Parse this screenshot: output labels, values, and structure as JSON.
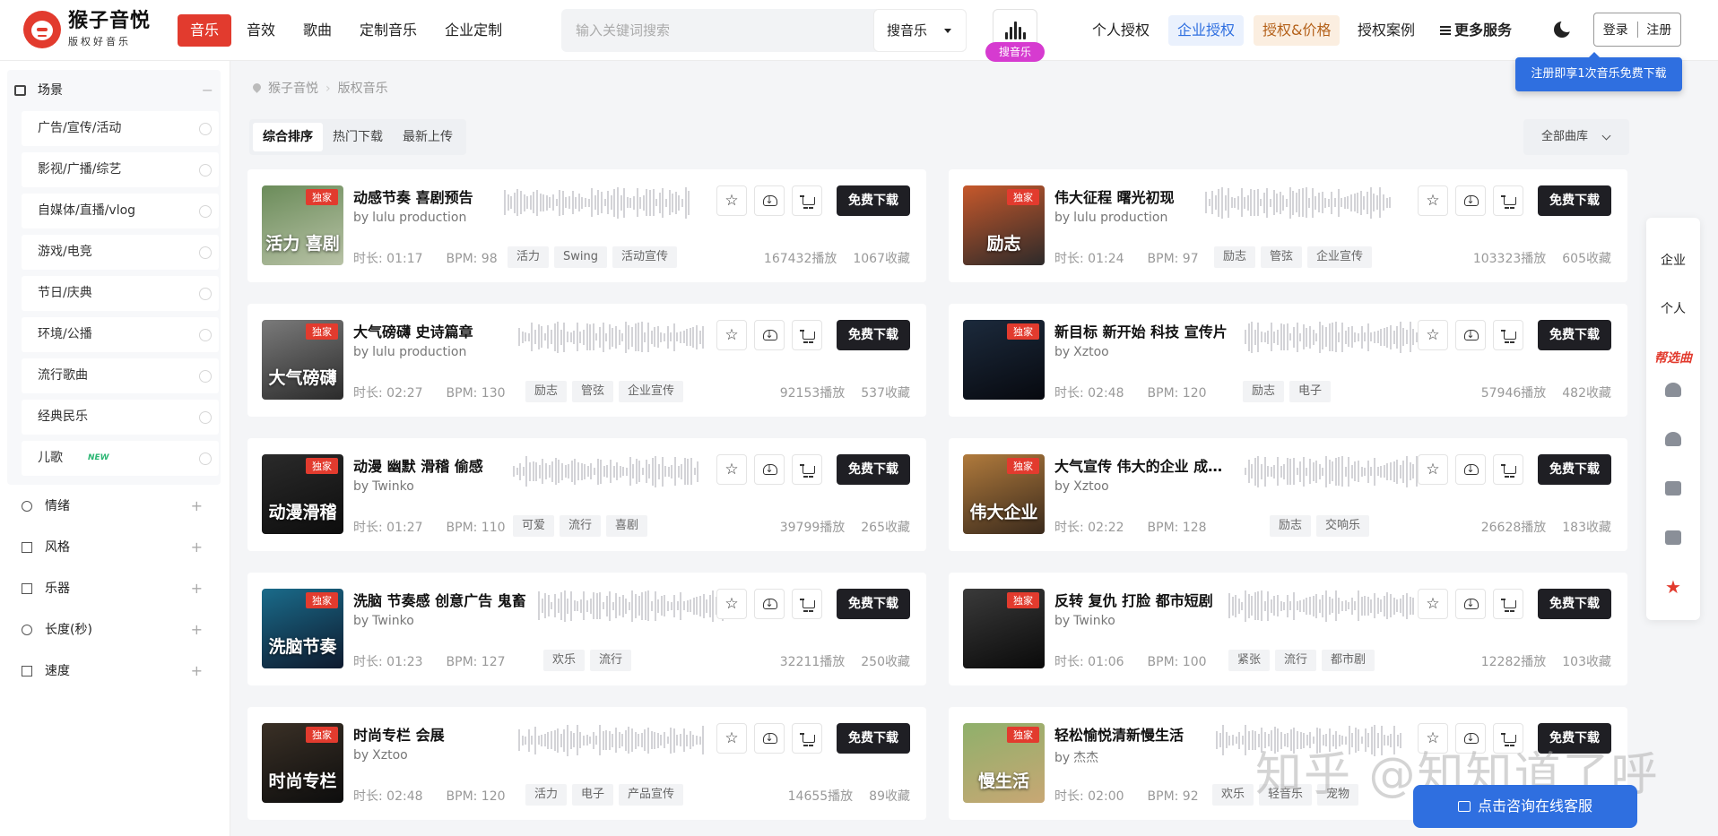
{
  "brand": {
    "name": "猴子音悦",
    "tagline": "版权好音乐"
  },
  "nav": {
    "items": [
      "音乐",
      "音效",
      "歌曲",
      "定制音乐",
      "企业定制"
    ]
  },
  "search": {
    "placeholder": "输入关键词搜索",
    "scope": "搜音乐",
    "voice_badge": "搜音乐"
  },
  "right_nav": {
    "personal": "个人授权",
    "enterprise": "企业授权",
    "pricing": "授权&价格",
    "cases": "授权案例",
    "more": "更多服务"
  },
  "auth": {
    "login": "登录",
    "register": "注册"
  },
  "promo": {
    "text": "注册即享1次音乐免费下载"
  },
  "sidebar": {
    "scene_title": "场景",
    "scenes": [
      {
        "label": "广告/宣传/活动"
      },
      {
        "label": "影视/广播/综艺"
      },
      {
        "label": "自媒体/直播/vlog"
      },
      {
        "label": "游戏/电竞"
      },
      {
        "label": "节日/庆典"
      },
      {
        "label": "环境/公播"
      },
      {
        "label": "流行歌曲"
      },
      {
        "label": "经典民乐"
      },
      {
        "label": "儿歌",
        "badge": "NEW"
      }
    ],
    "categories": [
      "情绪",
      "风格",
      "乐器",
      "长度(秒)",
      "速度"
    ]
  },
  "breadcrumb": {
    "home": "猴子音悦",
    "current": "版权音乐"
  },
  "sort_tabs": [
    "综合排序",
    "热门下载",
    "最新上传"
  ],
  "library": {
    "label": "全部曲库"
  },
  "labels": {
    "exclusive": "独家",
    "free_download": "免费下载",
    "by": "by"
  },
  "tracks": [
    {
      "title": "动感节奏 喜剧预告",
      "author": "lulu production",
      "duration": "时长: 01:17",
      "bpm": "BPM: 98",
      "tags": [
        "活力",
        "Swing",
        "活动宣传"
      ],
      "plays": "167432播放",
      "favs": "1067收藏",
      "cover_text": "活力 喜剧",
      "cover_colors": [
        "#6b8c5a",
        "#b8c2a6"
      ]
    },
    {
      "title": "伟大征程 曙光初现",
      "author": "lulu production",
      "duration": "时长: 01:24",
      "bpm": "BPM: 97",
      "tags": [
        "励志",
        "管弦",
        "企业宣传"
      ],
      "plays": "103323播放",
      "favs": "605收藏",
      "cover_text": "励志",
      "cover_colors": [
        "#c6582b",
        "#2d2a2a"
      ]
    },
    {
      "title": "大气磅礴 史诗篇章",
      "author": "lulu production",
      "duration": "时长: 02:27",
      "bpm": "BPM: 130",
      "tags": [
        "励志",
        "管弦",
        "企业宣传"
      ],
      "plays": "92153播放",
      "favs": "537收藏",
      "cover_text": "大气磅礴",
      "cover_colors": [
        "#7a7a7a",
        "#2b2b2b"
      ]
    },
    {
      "title": "新目标 新开始 科技 宣传片",
      "author": "Xztoo",
      "duration": "时长: 02:48",
      "bpm": "BPM: 120",
      "tags": [
        "励志",
        "电子"
      ],
      "plays": "57946播放",
      "favs": "482收藏",
      "cover_text": "",
      "cover_colors": [
        "#1c2a3c",
        "#07090f"
      ]
    },
    {
      "title": "动漫 幽默 滑稽 偷感",
      "author": "Twinko",
      "duration": "时长: 01:27",
      "bpm": "BPM: 110",
      "tags": [
        "可爱",
        "流行",
        "喜剧"
      ],
      "plays": "39799播放",
      "favs": "265收藏",
      "cover_text": "动漫滑稽",
      "cover_colors": [
        "#2a2a2a",
        "#0d0d0d"
      ]
    },
    {
      "title": "大气宣传 伟大的企业 成…",
      "author": "Xztoo",
      "duration": "时长: 02:22",
      "bpm": "BPM: 128",
      "tags": [
        "励志",
        "交响乐"
      ],
      "plays": "26628播放",
      "favs": "183收藏",
      "cover_text": "伟大企业",
      "cover_colors": [
        "#b07a3c",
        "#3a2a1c"
      ]
    },
    {
      "title": "洗脑 节奏感 创意广告 鬼畜",
      "author": "Twinko",
      "duration": "时长: 01:23",
      "bpm": "BPM: 127",
      "tags": [
        "欢乐",
        "流行"
      ],
      "plays": "32211播放",
      "favs": "250收藏",
      "cover_text": "洗脑节奏",
      "cover_colors": [
        "#1a6b8a",
        "#0e1a2e"
      ]
    },
    {
      "title": "反转 复仇 打脸 都市短剧",
      "author": "Twinko",
      "duration": "时长: 01:06",
      "bpm": "BPM: 100",
      "tags": [
        "紧张",
        "流行",
        "都市剧"
      ],
      "plays": "12282播放",
      "favs": "103收藏",
      "cover_text": "",
      "cover_colors": [
        "#3a3a3a",
        "#0a0a0a"
      ]
    },
    {
      "title": "时尚专栏 会展",
      "author": "Xztoo",
      "duration": "时长: 02:48",
      "bpm": "BPM: 120",
      "tags": [
        "活力",
        "电子",
        "产品宣传"
      ],
      "plays": "14655播放",
      "favs": "89收藏",
      "cover_text": "时尚专栏",
      "cover_colors": [
        "#3a3026",
        "#0d0d0d"
      ]
    },
    {
      "title": "轻松愉悦清新慢生活",
      "author": "杰杰",
      "duration": "时长: 02:00",
      "bpm": "BPM: 92",
      "tags": [
        "欢乐",
        "轻音乐",
        "宠物"
      ],
      "plays": "",
      "favs": "",
      "cover_text": "慢生活",
      "cover_colors": [
        "#8fb06b",
        "#c8a774"
      ]
    }
  ],
  "float_panel": {
    "enterprise": "企业",
    "personal": "个人",
    "special": "帮选曲"
  },
  "watermark": "知乎 @知知道了呼",
  "chat": {
    "label": "点击咨询在线客服"
  },
  "colors": {
    "brand_red": "#e23b2e",
    "accent_blue": "#2f6fe0",
    "dark_button": "#1f1f24",
    "voice_badge": "#d63bd0"
  }
}
